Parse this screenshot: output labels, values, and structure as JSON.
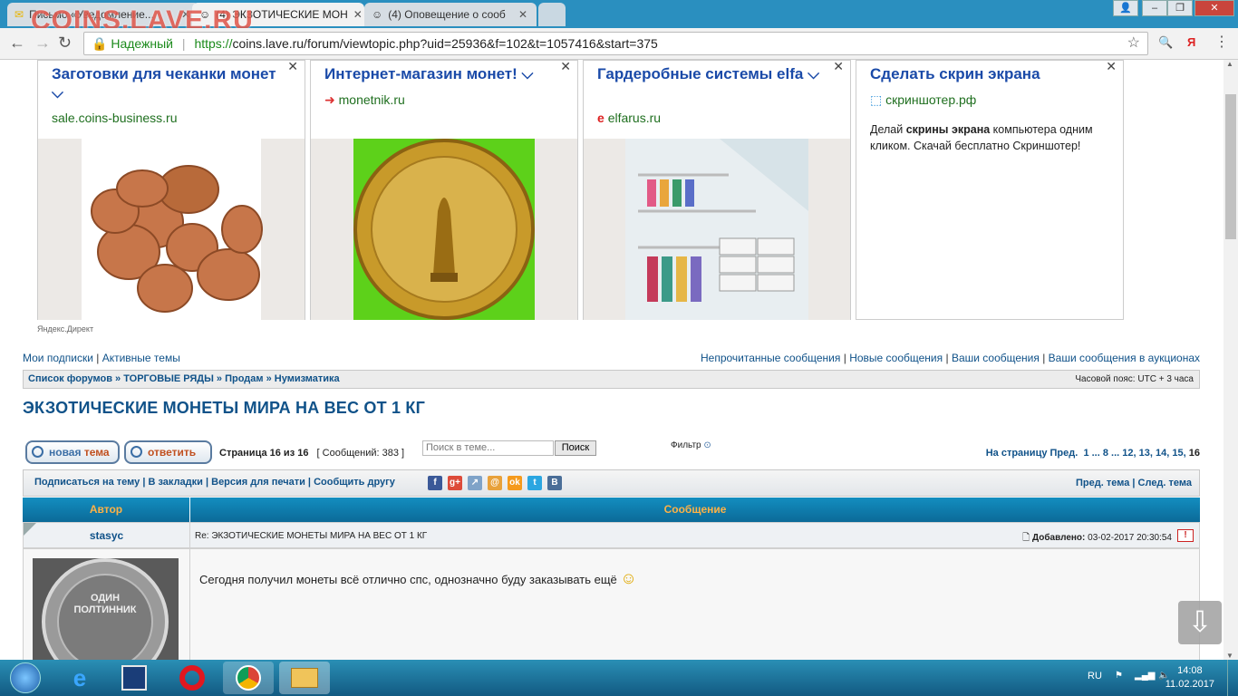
{
  "watermark": "COINS.LAVE.RU",
  "browser": {
    "tabs": [
      {
        "label": "Письмо «Уведомление..."
      },
      {
        "label": "(4) ЭКЗОТИЧЕСКИЕ МОН"
      },
      {
        "label": "(4) Оповещение о сооб"
      }
    ],
    "secure_label": "Надежный",
    "url_scheme": "https://",
    "url_rest": "coins.lave.ru/forum/viewtopic.php?uid=25936&f=102&t=1057416&start=375"
  },
  "ads": [
    {
      "title": "Заготовки для чеканки монет",
      "domain": "sale.coins-business.ru"
    },
    {
      "title": "Интернет-магазин монет!",
      "domain": "monetnik.ru"
    },
    {
      "title": "Гардеробные системы elfa",
      "domain": "elfarus.ru"
    },
    {
      "title": "Сделать скрин экрана",
      "domain": "скриншотер.рф",
      "desc_pre": "Делай ",
      "desc_bold": "скрины экрана",
      "desc_post": " компьютера одним кликом. Скачай бесплатно Скриншотер!"
    }
  ],
  "yandex_direct": "Яндекс.Директ",
  "topnav": {
    "left": [
      "Мои подписки",
      "Активные темы"
    ],
    "right": [
      "Непрочитанные сообщения",
      "Новые сообщения",
      "Ваши сообщения",
      "Ваши сообщения в аукционах"
    ]
  },
  "breadcrumb": {
    "items": [
      "Список форумов",
      "ТОРГОВЫЕ РЯДЫ",
      "Продам",
      "Нумизматика"
    ],
    "timezone": "Часовой пояс: UTC + 3 часа"
  },
  "topic_title": "ЭКЗОТИЧЕСКИЕ МОНЕТЫ МИРА НА ВЕС ОТ 1 КГ",
  "buttons": {
    "new_topic_a": "новая ",
    "new_topic_b": "тема",
    "reply": "ответить",
    "search": "Поиск"
  },
  "page_info": "Страница 16 из 16",
  "messages_count": "[ Сообщений: 383 ]",
  "search_placeholder": "Поиск в теме...",
  "filter": "Фильтр",
  "pagination": {
    "label": "На страницу",
    "prev": "Пред.",
    "pages": [
      "1",
      "8",
      "12",
      "13",
      "14",
      "15",
      "16"
    ]
  },
  "tools": {
    "subscribe": "Подписаться на тему",
    "bookmarks": "В закладки",
    "print": "Версия для печати",
    "share": "Сообщить другу",
    "prev_topic": "Пред. тема",
    "next_topic": "След. тема"
  },
  "share_icons": [
    "facebook-icon",
    "googleplus-icon",
    "vk-link-icon",
    "mail-icon",
    "odnoklassniki-icon",
    "twitter-icon",
    "vkontakte-icon"
  ],
  "table": {
    "col_author": "Автор",
    "col_message": "Сообщение"
  },
  "post": {
    "author": "stasyc",
    "subject": "Re: ЭКЗОТИЧЕСКИЕ МОНЕТЫ МИРА НА ВЕС ОТ 1 КГ",
    "added_label": "Добавлено:",
    "added_date": "03-02-2017 20:30:54",
    "text": "Сегодня получил монеты всё отлично спс, однозначно буду заказывать ещё",
    "avatar_text_1": "ОДИН",
    "avatar_text_2": "ПОЛТИННИК"
  },
  "taskbar": {
    "lang": "RU",
    "time": "14:08",
    "date": "11.02.2017"
  },
  "colors": {
    "link": "#105289",
    "header_bg": "#0b6a98",
    "header_text": "#ffb246",
    "ad_title": "#1a4aa8"
  }
}
